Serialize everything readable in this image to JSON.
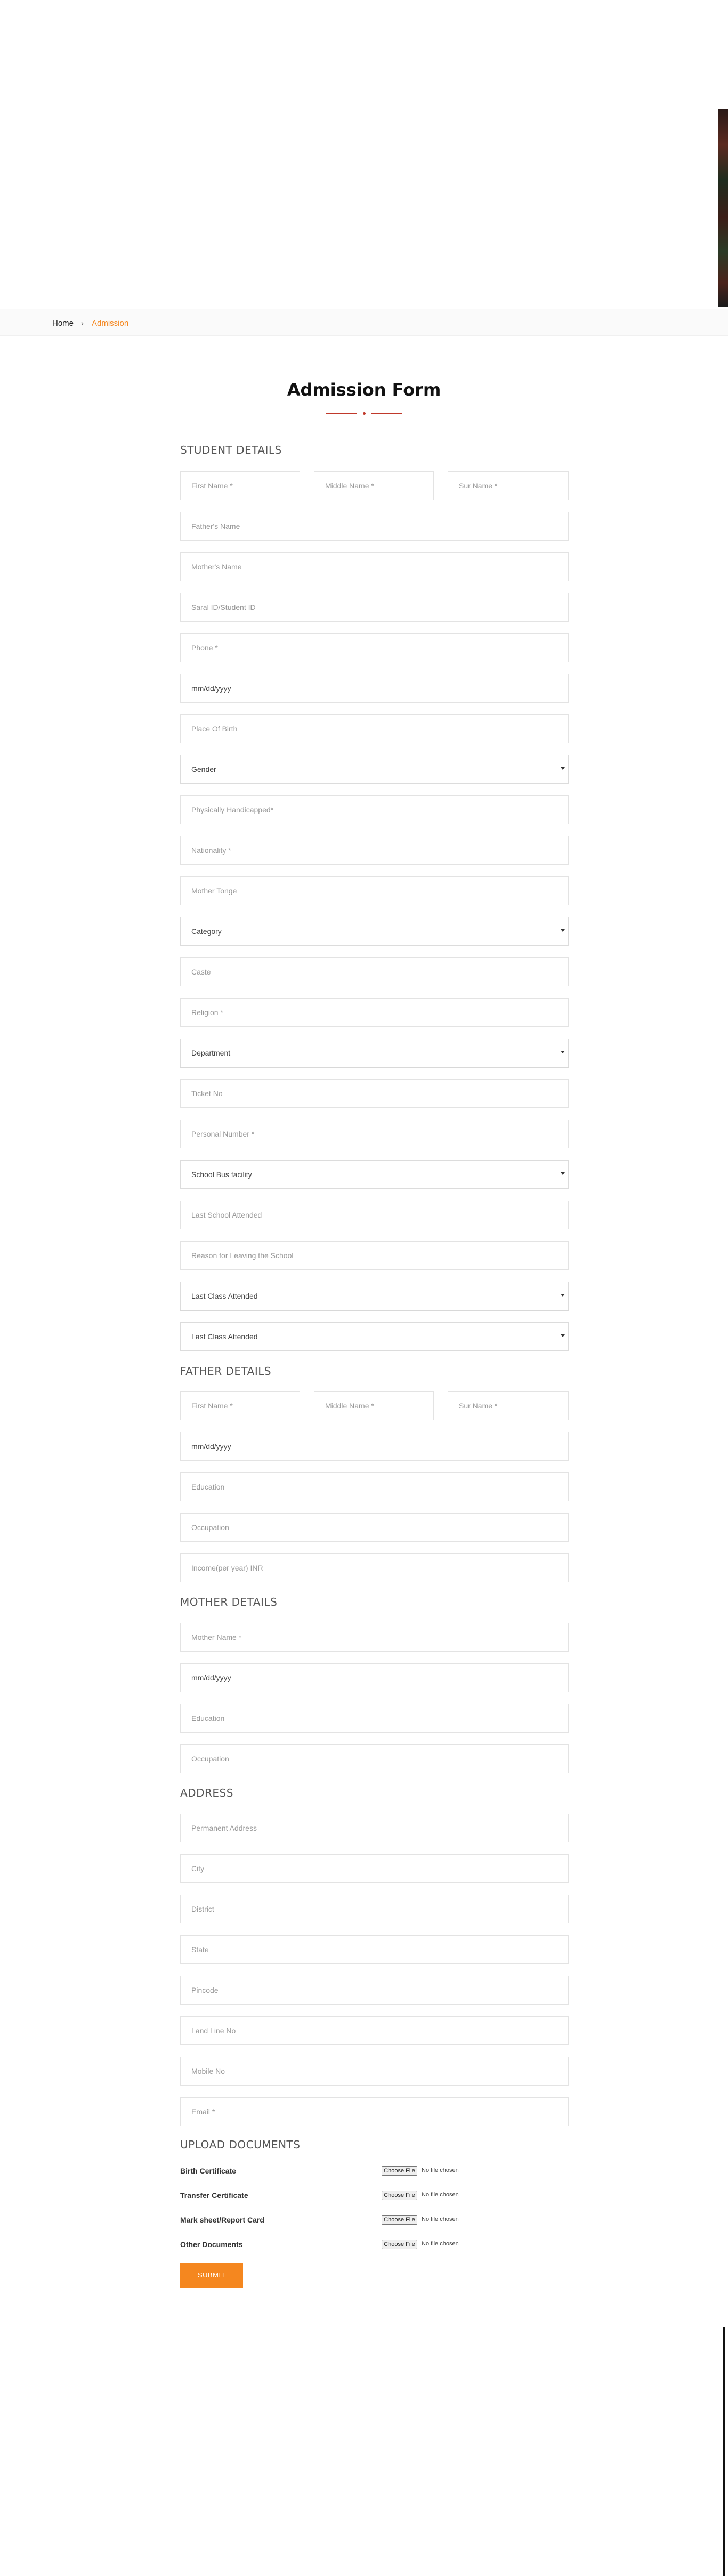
{
  "breadcrumb": {
    "home": "Home",
    "separator": "›",
    "current": "Admission"
  },
  "form": {
    "title": "Admission Form"
  },
  "student": {
    "heading": "STUDENT DETAILS",
    "first_name": "First Name *",
    "middle_name": "Middle Name *",
    "sur_name": "Sur Name *",
    "fathers_name": "Father's Name",
    "mothers_name": "Mother's Name",
    "saral_id": "Saral ID/Student ID",
    "phone": "Phone *",
    "dob": "mm/dd/yyyy",
    "place_of_birth": "Place Of Birth",
    "gender": "Gender",
    "physically_handicapped": "Physically Handicapped*",
    "nationality": "Nationality *",
    "mother_tongue": "Mother Tonge",
    "category": "Category",
    "caste": "Caste",
    "religion": "Religion *",
    "department": "Department",
    "ticket_no": "Ticket No",
    "personal_number": "Personal Number *",
    "school_bus": "School Bus facility",
    "last_school": "Last School Attended",
    "reason_leaving": "Reason for Leaving the School",
    "last_class_1": "Last Class Attended",
    "last_class_2": "Last Class Attended"
  },
  "father": {
    "heading": "FATHER DETAILS",
    "first_name": "First Name *",
    "middle_name": "Middle Name *",
    "sur_name": "Sur Name *",
    "dob": "mm/dd/yyyy",
    "education": "Education",
    "occupation": "Occupation",
    "income": "Income(per year) INR"
  },
  "mother": {
    "heading": "MOTHER DETAILS",
    "name": "Mother Name *",
    "dob": "mm/dd/yyyy",
    "education": "Education",
    "occupation": "Occupation"
  },
  "address": {
    "heading": "ADDRESS",
    "permanent": "Permanent Address",
    "city": "City",
    "district": "District",
    "state": "State",
    "pincode": "Pincode",
    "land_line": "Land Line No",
    "mobile": "Mobile No",
    "email": "Email *"
  },
  "uploads": {
    "heading": "UPLOAD DOCUMENTS",
    "choose_label": "Choose File",
    "no_file": "No file chosen",
    "birth_certificate": "Birth Certificate",
    "transfer_certificate": "Transfer Certificate",
    "mark_sheet": "Mark sheet/Report Card",
    "other_documents": "Other Documents"
  },
  "submit_label": "SUBMIT",
  "colors": {
    "accent": "#f5871f",
    "divider": "#c0392b"
  }
}
